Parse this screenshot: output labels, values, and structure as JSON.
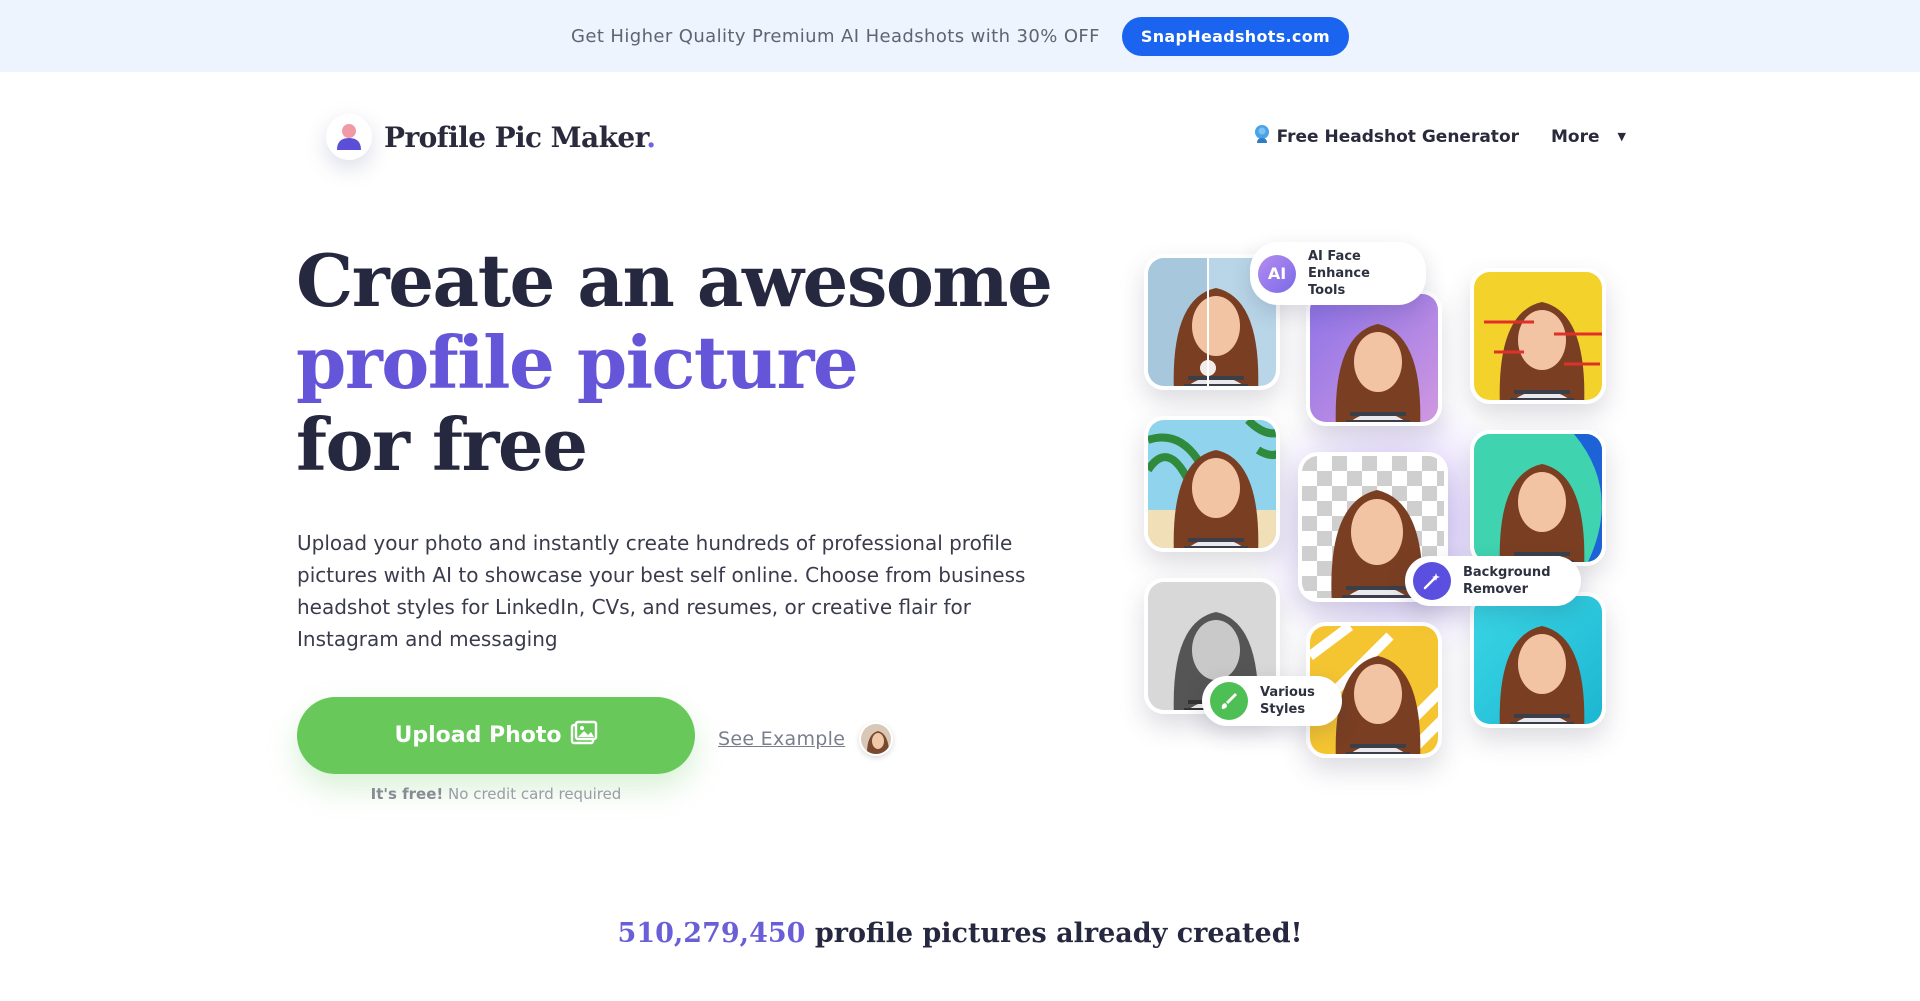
{
  "promo": {
    "text": "Get Higher Quality Premium AI Headshots with 30% OFF",
    "button_label": "SnapHeadshots.com"
  },
  "brand": {
    "name": "Profile Pic Maker",
    "dot": "."
  },
  "nav": {
    "headshot_label": "Free Headshot Generator",
    "more_label": "More"
  },
  "hero": {
    "title_line1": "Create an awesome",
    "title_line2": "profile picture",
    "title_line3": "for free",
    "description": "Upload your photo and instantly create hundreds of professional profile pictures with AI to showcase your best self online. Choose from business headshot styles for LinkedIn, CVs, and resumes, or creative flair for Instagram and messaging"
  },
  "cta": {
    "upload_label": "Upload Photo",
    "see_example_label": "See Example",
    "free_bold": "It's free!",
    "free_rest": "No credit card required"
  },
  "collage": {
    "badges": {
      "ai_icon": "AI",
      "ai_line1": "AI Face",
      "ai_line2": "Enhance Tools",
      "bg_line1": "Background",
      "bg_line2": "Remover",
      "styles_line1": "Various",
      "styles_line2": "Styles"
    }
  },
  "counter": {
    "number": "510,279,450",
    "suffix": "profile pictures already created!"
  },
  "colors": {
    "accent_purple": "#6556d9",
    "upload_green": "#68c95a",
    "promo_blue": "#1a64f0"
  }
}
